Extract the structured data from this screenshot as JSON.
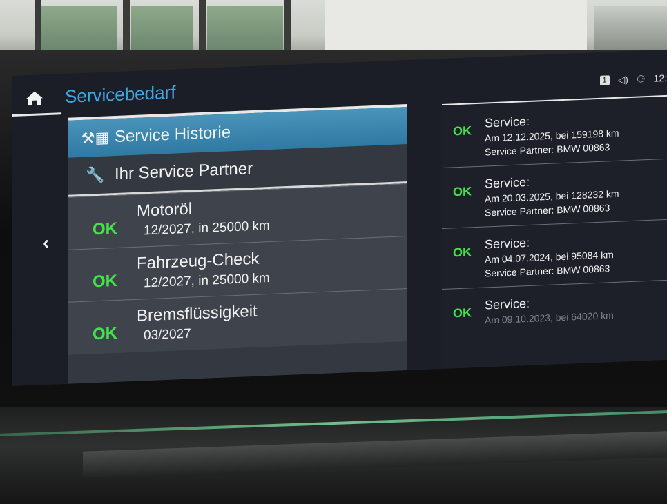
{
  "header": {
    "title": "Servicebedarf",
    "status_badge": "1",
    "clock": "12:"
  },
  "menu": {
    "history_label": "Service Historie",
    "partner_label": "Ihr Service Partner"
  },
  "services": [
    {
      "status": "OK",
      "name": "Motoröl",
      "info": "12/2027, in 25000 km"
    },
    {
      "status": "OK",
      "name": "Fahrzeug-Check",
      "info": "12/2027, in 25000 km"
    },
    {
      "status": "OK",
      "name": "Bremsflüssigkeit",
      "info": "03/2027"
    }
  ],
  "history": [
    {
      "status": "OK",
      "label": "Service:",
      "line1": "Am 12.12.2025, bei 159198 km",
      "line2": "Service Partner: BMW 00863"
    },
    {
      "status": "OK",
      "label": "Service:",
      "line1": "Am 20.03.2025, bei 128232 km",
      "line2": "Service Partner: BMW 00863"
    },
    {
      "status": "OK",
      "label": "Service:",
      "line1": "Am 04.07.2024, bei 95084 km",
      "line2": "Service Partner: BMW 00863"
    },
    {
      "status": "OK",
      "label": "Service:",
      "line1": "Am 09.10.2023, bei 64020 km",
      "line2": ""
    }
  ],
  "colors": {
    "accent": "#3fa7e6",
    "ok": "#44e24a",
    "highlight": "#3a88b2"
  }
}
